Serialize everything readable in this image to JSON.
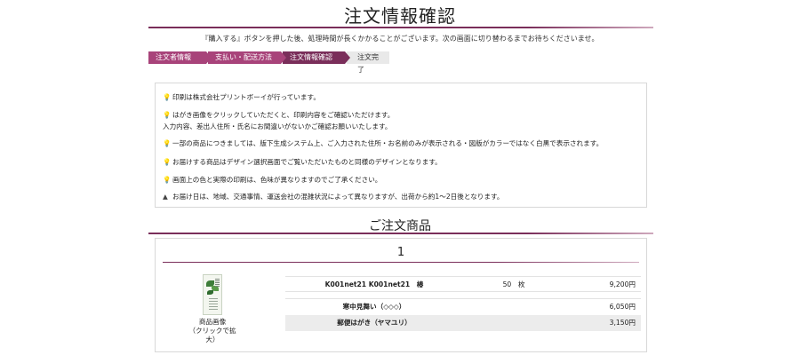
{
  "header": {
    "title": "注文情報確認",
    "notice": "『購入する』ボタンを押した後、処理時間が長くかかることがございます。次の画面に切り替わるまでお待ちくださいませ。"
  },
  "steps": [
    {
      "label": "注文者情報入力"
    },
    {
      "label": "支払い・配送方法"
    },
    {
      "label": "注文情報確認"
    },
    {
      "label": "注文完了"
    }
  ],
  "info": {
    "lines": [
      {
        "icon": "bulb-icon",
        "glyph": "💡",
        "text": "印刷は株式会社プリントボーイが行っています。"
      },
      {
        "icon": "bulb-icon",
        "glyph": "💡",
        "text": "はがき画像をクリックしていただくと、印刷内容をご確認いただけます。"
      },
      {
        "icon": "",
        "glyph": "",
        "text": "入力内容、差出人住所・氏名にお間違いがないかご確認お願いいたします。"
      },
      {
        "icon": "bulb-icon",
        "glyph": "💡",
        "text": "一部の商品につきましては、版下生成システム上、ご入力された住所・お名前のみが表示される・図版がカラーではなく白黒で表示されます。"
      },
      {
        "icon": "bulb-icon",
        "glyph": "💡",
        "text": "お届けする商品はデザイン選択画面でご覧いただいたものと同様のデザインとなります。"
      },
      {
        "icon": "bulb-icon",
        "glyph": "💡",
        "text": "画面上の色と実際の印刷は、色味が異なりますのでご了承ください。"
      },
      {
        "icon": "warning-icon",
        "glyph": "▲",
        "text": "お届け日は、地域、交通事情、運送会社の混雑状況によって異なりますが、出荷から約1〜2日後となります。"
      }
    ]
  },
  "orders": {
    "section_title": "ご注文商品",
    "item_number": "1",
    "thumb_caption_1": "商品画像",
    "thumb_caption_2": "（クリックで拡大）",
    "rows": [
      {
        "name": "K001net21 K001net21　椿",
        "qty": "50　枚",
        "price": "9,200円"
      },
      {
        "name": "寒中見舞い（◇◇◇）",
        "qty": "",
        "price": "6,050円"
      },
      {
        "name": "郵便はがき（ヤマユリ）",
        "qty": "",
        "price": "3,150円"
      }
    ]
  },
  "colors": {
    "accent": "#7a2e5a",
    "step_active": "#a8437a",
    "step_done": "#e9e9e9"
  }
}
